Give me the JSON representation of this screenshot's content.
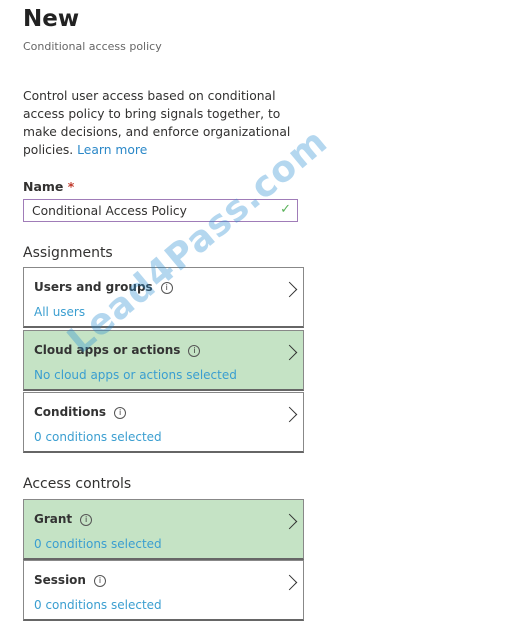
{
  "header": {
    "title": "New",
    "subtitle": "Conditional access policy"
  },
  "description": {
    "text": "Control user access based on conditional access policy to bring signals together, to make decisions, and enforce organizational policies. ",
    "link": "Learn more"
  },
  "name_field": {
    "label": "Name",
    "required_mark": "*",
    "value": "Conditional Access Policy",
    "valid_icon": "check-icon"
  },
  "assignments": {
    "heading": "Assignments",
    "items": [
      {
        "title": "Users and groups",
        "summary": "All users",
        "highlighted": false
      },
      {
        "title": "Cloud apps or actions",
        "summary": "No cloud apps or actions selected",
        "highlighted": true
      },
      {
        "title": "Conditions",
        "summary": "0 conditions selected",
        "highlighted": false
      }
    ]
  },
  "access_controls": {
    "heading": "Access controls",
    "items": [
      {
        "title": "Grant",
        "summary": "0 conditions selected",
        "highlighted": true
      },
      {
        "title": "Session",
        "summary": "0 conditions selected",
        "highlighted": false
      }
    ]
  },
  "colors": {
    "highlight": "#c5e3c5",
    "link": "#3a9ed0",
    "input_border": "#a07cb8"
  },
  "watermark": "Lead4Pass.com"
}
